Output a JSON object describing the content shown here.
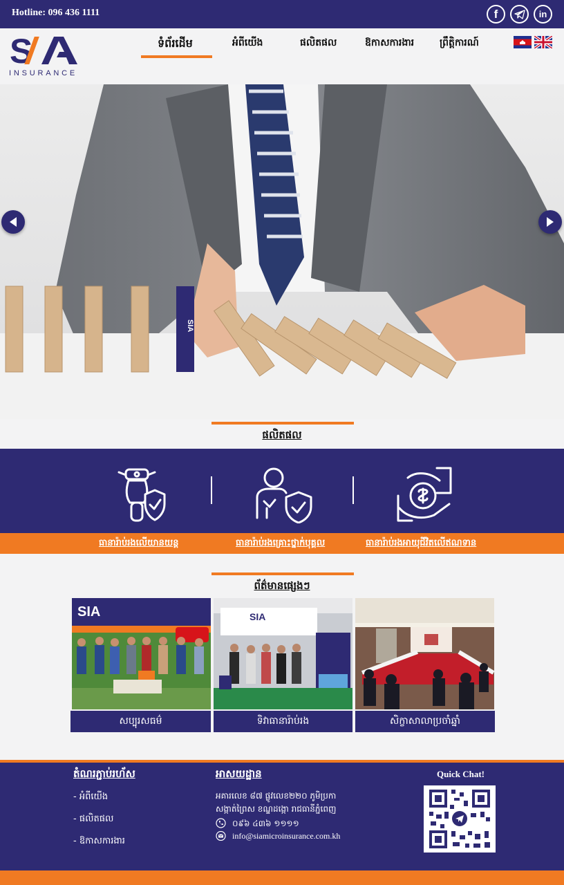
{
  "topbar": {
    "hotline": "Hotline: 096 436 1111",
    "social": [
      {
        "icon": "facebook-icon",
        "glyph": "f"
      },
      {
        "icon": "telegram-icon",
        "glyph": "➤"
      },
      {
        "icon": "linkedin-icon",
        "glyph": "in"
      }
    ]
  },
  "logo": {
    "mark": "SIA",
    "sub": "INSURANCE"
  },
  "nav": {
    "items": [
      "ទំព័រដើម",
      "អំពីយើង",
      "ផលិតផល",
      "ឱកាសការងារ",
      "ព្រឹត្តិការណ៍"
    ],
    "active": 0
  },
  "languages": [
    "km-flag",
    "en-flag"
  ],
  "hero": {
    "block_label": "SIA"
  },
  "products": {
    "title": "ផលិតផល",
    "items": [
      {
        "label": "ធានារ៉ាប់រងលើយានយន្ត",
        "icon": "motorbike-shield-icon"
      },
      {
        "label": "ធានារ៉ាប់រងគ្រោះថ្នាក់បុគ្គល",
        "icon": "person-shield-icon"
      },
      {
        "label": "ធានារ៉ាប់រងអាយុជីវិតលើឥណទាន",
        "icon": "hand-coin-icon"
      }
    ]
  },
  "news": {
    "title": "ព័ត៌មានផ្សេងៗ",
    "items": [
      {
        "caption": "សប្បុរសធម៌"
      },
      {
        "caption": "ទិវាធានារ៉ាប់រង"
      },
      {
        "caption": "សិក្ខាសាលាប្រចាំឆ្នាំ"
      }
    ]
  },
  "footer": {
    "links_title": "តំណរភ្ជាប់រហ័ស",
    "links": [
      "- អំពីយើង",
      "- ផលិតផល",
      "- ឱកាសការងារ"
    ],
    "address_title": "អាសយដ្ឋាន",
    "address_line1": "អគារលេខ ៨៧ ផ្លូវលេខ២២០ ភូមិប្រកា",
    "address_line2": "សង្កាត់ព្រៃស ខណ្ឌដង្កោ រាជធានីភ្នំពេញ",
    "phone": "០៩៦ ៤៣៦ ១១១១",
    "email": "info@siamicroinsurance.com.kh",
    "quick_chat": "Quick Chat!"
  },
  "colors": {
    "navy": "#2e2a73",
    "orange": "#f07a22"
  }
}
